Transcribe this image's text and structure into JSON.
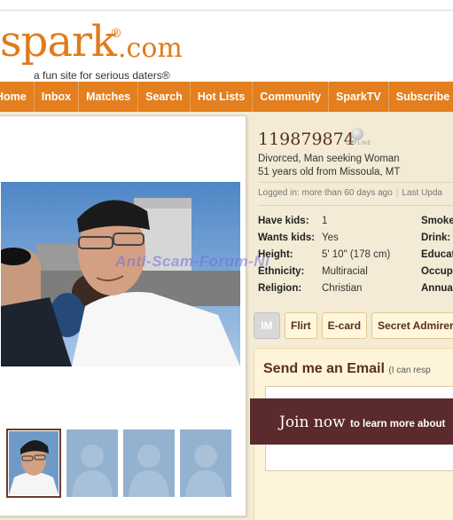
{
  "logo": {
    "name": "spark",
    "reg": "®",
    "tld": ".com",
    "tagline": "a fun site for serious daters®"
  },
  "nav": [
    "Home",
    "Inbox",
    "Matches",
    "Search",
    "Hot Lists",
    "Community",
    "SparkTV",
    "Subscribe"
  ],
  "profile": {
    "id": "119879874",
    "status": "OFFLINE",
    "line1": "Divorced, Man seeking Woman",
    "line2": "51 years old from Missoula, MT",
    "logged_in": "Logged in: more than 60 days ago",
    "last_updated": "Last Upda"
  },
  "details": [
    {
      "key": "Have kids:",
      "value": "1",
      "key2": "Smoke"
    },
    {
      "key": "Wants kids:",
      "value": "Yes",
      "key2": "Drink:"
    },
    {
      "key": "Height:",
      "value": "5' 10\" (178 cm)",
      "key2": "Educat"
    },
    {
      "key": "Ethnicity:",
      "value": "Multiracial",
      "key2": "Occup"
    },
    {
      "key": "Religion:",
      "value": "Christian",
      "key2": "Annua"
    }
  ],
  "actions": {
    "im": "IM",
    "flirt": "Flirt",
    "ecard": "E-card",
    "secret_admirer": "Secret Admirer"
  },
  "email": {
    "title": "Send me an Email",
    "subtitle": "(I can resp"
  },
  "join": {
    "main": "Join now",
    "rest": "to learn more about"
  },
  "watermark": "Anti-Scam-Forum-Nl",
  "colors": {
    "brand_orange": "#e37f1e",
    "maroon": "#5a2a2c",
    "cream": "#f3ebd5"
  }
}
